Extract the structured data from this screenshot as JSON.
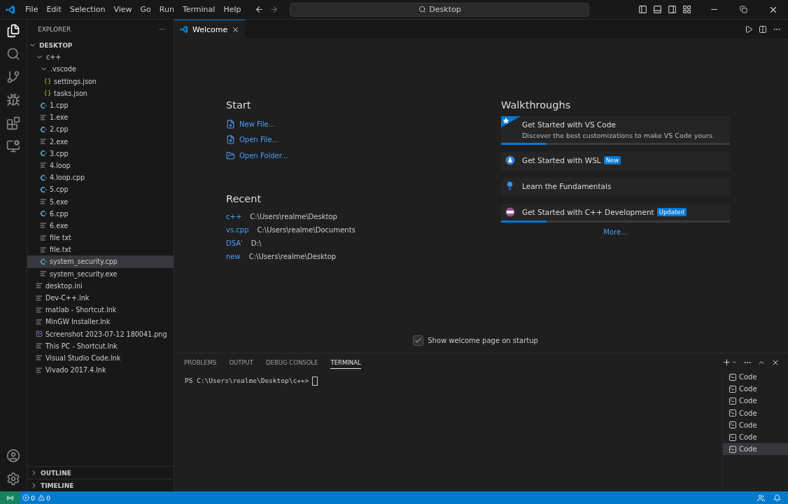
{
  "menu": [
    "File",
    "Edit",
    "Selection",
    "View",
    "Go",
    "Run",
    "Terminal",
    "Help"
  ],
  "command_center": {
    "label": "Desktop"
  },
  "sidebar": {
    "title": "EXPLORER",
    "more": "···",
    "root": {
      "label": "DESKTOP",
      "expanded": true,
      "children": [
        {
          "label": "c++",
          "kind": "folder",
          "expanded": true,
          "selected": false,
          "children": [
            {
              "label": ".vscode",
              "kind": "folder",
              "expanded": true,
              "selected": false,
              "children": [
                {
                  "label": "settings.json",
                  "kind": "json",
                  "selected": false
                },
                {
                  "label": "tasks.json",
                  "kind": "json",
                  "selected": false
                }
              ]
            },
            {
              "label": "1.cpp",
              "kind": "cpp",
              "selected": false
            },
            {
              "label": "1.exe",
              "kind": "file",
              "selected": false
            },
            {
              "label": "2.cpp",
              "kind": "cpp",
              "selected": false
            },
            {
              "label": "2.exe",
              "kind": "file",
              "selected": false
            },
            {
              "label": "3.cpp",
              "kind": "cpp",
              "selected": false
            },
            {
              "label": "4.loop",
              "kind": "file",
              "selected": false
            },
            {
              "label": "4.loop.cpp",
              "kind": "cpp",
              "selected": false
            },
            {
              "label": "5.cpp",
              "kind": "cpp",
              "selected": false
            },
            {
              "label": "5.exe",
              "kind": "file",
              "selected": false
            },
            {
              "label": "6.cpp",
              "kind": "cpp",
              "selected": false
            },
            {
              "label": "6.exe",
              "kind": "file",
              "selected": false
            },
            {
              "label": "file txt",
              "kind": "file",
              "selected": false
            },
            {
              "label": "file.txt",
              "kind": "file",
              "selected": false
            },
            {
              "label": "system_security.cpp",
              "kind": "cpp",
              "selected": true
            },
            {
              "label": "system_security.exe",
              "kind": "file",
              "selected": false
            }
          ]
        },
        {
          "label": "desktop.ini",
          "kind": "file",
          "selected": false
        },
        {
          "label": "Dev-C++.lnk",
          "kind": "file",
          "selected": false
        },
        {
          "label": "matlab - Shortcut.lnk",
          "kind": "file",
          "selected": false
        },
        {
          "label": "MinGW Installer.lnk",
          "kind": "file",
          "selected": false
        },
        {
          "label": "Screenshot 2023-07-12 180041.png",
          "kind": "image",
          "selected": false
        },
        {
          "label": "This PC - Shortcut.lnk",
          "kind": "file",
          "selected": false
        },
        {
          "label": "Visual Studio Code.lnk",
          "kind": "file",
          "selected": false
        },
        {
          "label": "Vivado 2017.4.lnk",
          "kind": "file",
          "selected": false
        }
      ]
    },
    "sections": [
      {
        "label": "OUTLINE",
        "expanded": false
      },
      {
        "label": "TIMELINE",
        "expanded": false
      }
    ]
  },
  "tabs": [
    {
      "label": "Welcome",
      "selected": true
    }
  ],
  "welcome": {
    "start_title": "Start",
    "start": [
      {
        "label": "New File...",
        "kind": "new-file"
      },
      {
        "label": "Open File...",
        "kind": "open-file"
      },
      {
        "label": "Open Folder...",
        "kind": "open-folder"
      }
    ],
    "recent_title": "Recent",
    "recent": [
      {
        "name": "c++",
        "path": "C:\\Users\\realme\\Desktop"
      },
      {
        "name": "vs.cpp",
        "path": "C:\\Users\\realme\\Documents"
      },
      {
        "name": "DSA'",
        "path": "D:\\"
      },
      {
        "name": "new",
        "path": "C:\\Users\\realme\\Desktop"
      }
    ],
    "walkthroughs_title": "Walkthroughs",
    "walkthroughs": [
      {
        "title": "Get Started with VS Code",
        "description": "Discover the best customizations to make VS Code yours.",
        "kind": "featured",
        "level": 0.2
      },
      {
        "title": "Get Started with WSL",
        "badge": "New",
        "kind": "penguin"
      },
      {
        "title": "Learn the Fundamentals",
        "kind": "bulb"
      },
      {
        "title": "Get Started with C++ Development",
        "badge": "Updated",
        "kind": "cpp",
        "level": 0.2
      }
    ],
    "more": "More...",
    "show_on_startup": {
      "label": "Show welcome page on startup",
      "checked": true
    }
  },
  "panel": {
    "tabs": [
      {
        "label": "PROBLEMS",
        "selected": false
      },
      {
        "label": "OUTPUT",
        "selected": false
      },
      {
        "label": "DEBUG CONSOLE",
        "selected": false
      },
      {
        "label": "TERMINAL",
        "selected": true
      }
    ],
    "prompt": "PS C:\\Users\\realme\\Desktop\\c++>",
    "terminals": [
      {
        "label": "Code",
        "selected": false
      },
      {
        "label": "Code",
        "selected": false
      },
      {
        "label": "Code",
        "selected": false
      },
      {
        "label": "Code",
        "selected": false
      },
      {
        "label": "Code",
        "selected": false
      },
      {
        "label": "Code",
        "selected": false
      },
      {
        "label": "Code",
        "selected": true
      }
    ]
  },
  "status_bar": {
    "errors": "0",
    "warnings": "0"
  }
}
